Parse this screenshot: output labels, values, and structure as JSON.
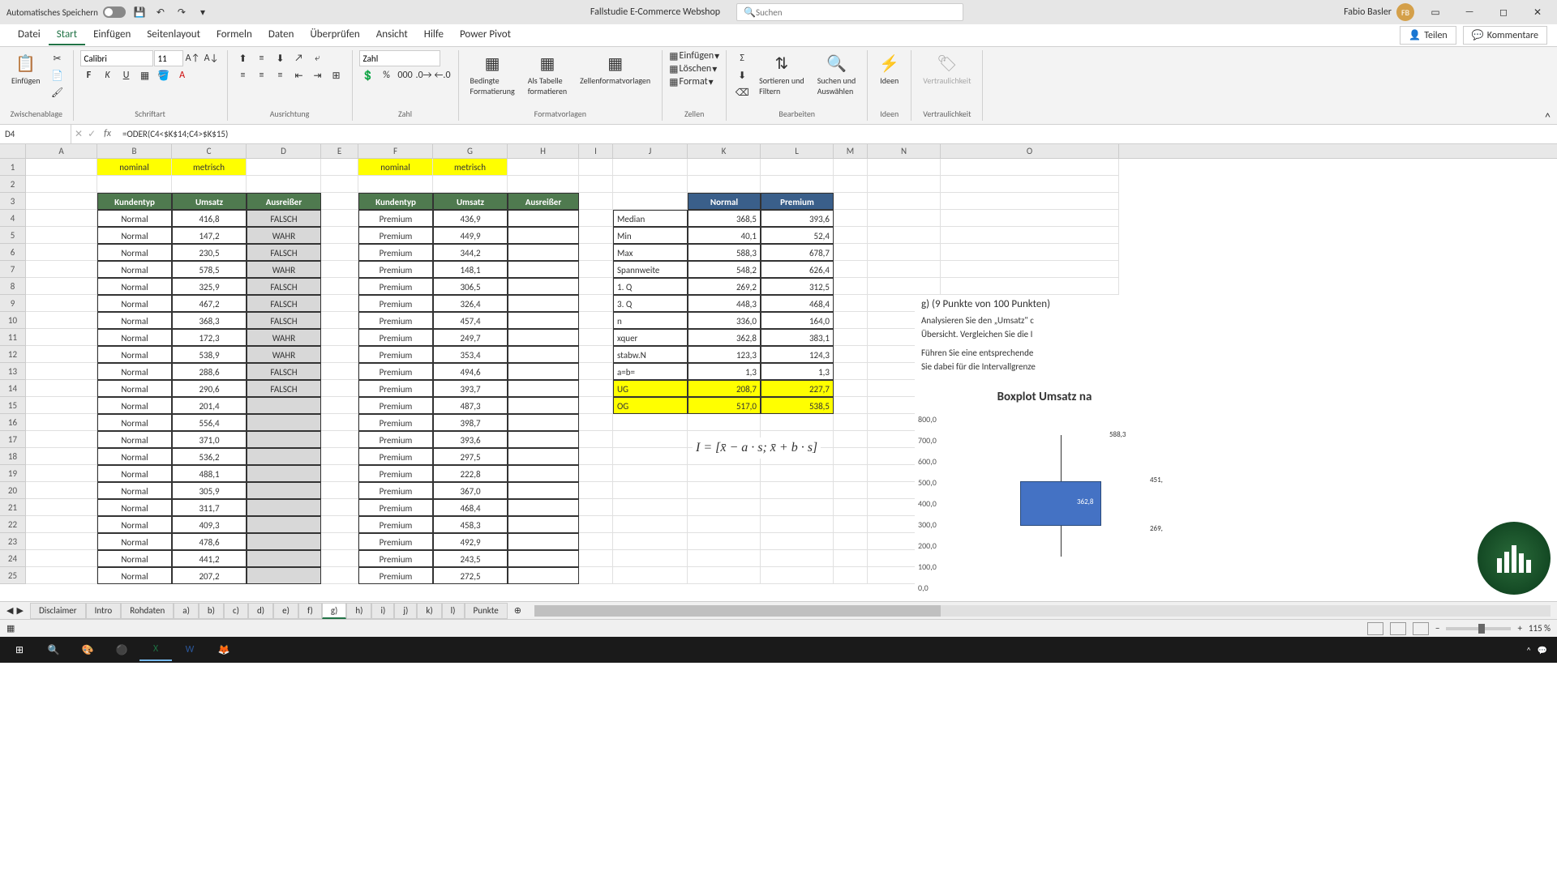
{
  "titlebar": {
    "autosave": "Automatisches Speichern",
    "doc_title": "Fallstudie E-Commerce Webshop",
    "search_placeholder": "Suchen",
    "user_name": "Fabio Basler",
    "user_initials": "FB"
  },
  "ribbon_tabs": [
    "Datei",
    "Start",
    "Einfügen",
    "Seitenlayout",
    "Formeln",
    "Daten",
    "Überprüfen",
    "Ansicht",
    "Hilfe",
    "Power Pivot"
  ],
  "ribbon_active": 1,
  "share": "Teilen",
  "comments": "Kommentare",
  "ribbon": {
    "paste": "Einfügen",
    "font_name": "Calibri",
    "font_size": "11",
    "num_format": "Zahl",
    "cond_fmt": "Bedingte\nFormatierung",
    "table_fmt": "Als Tabelle\nformatieren",
    "cell_styles": "Zellenformatvorlagen",
    "insert": "Einfügen",
    "delete": "Löschen",
    "format": "Format",
    "sort_filter": "Sortieren und\nFiltern",
    "find_select": "Suchen und\nAuswählen",
    "ideas": "Ideen",
    "sensitivity": "Vertraulichkeit",
    "g_clipboard": "Zwischenablage",
    "g_font": "Schriftart",
    "g_align": "Ausrichtung",
    "g_number": "Zahl",
    "g_styles": "Formatvorlagen",
    "g_cells": "Zellen",
    "g_editing": "Bearbeiten",
    "g_ideas": "Ideen",
    "g_sens": "Vertraulichkeit"
  },
  "namebox": "D4",
  "formula": "=ODER(C4<$K$14;C4>$K$15)",
  "columns": [
    "A",
    "B",
    "C",
    "D",
    "E",
    "F",
    "G",
    "H",
    "I",
    "J",
    "K",
    "L",
    "M",
    "N",
    "O"
  ],
  "col_widths": [
    "c-A",
    "c-B",
    "c-C",
    "c-D",
    "c-E",
    "c-F",
    "c-G",
    "c-H",
    "c-I",
    "c-J",
    "c-K",
    "c-L",
    "c-M",
    "c-N",
    "c-O"
  ],
  "labels": {
    "nominal": "nominal",
    "metrisch": "metrisch",
    "kundentyp": "Kundentyp",
    "umsatz": "Umsatz",
    "ausreisser": "Ausreißer",
    "normal": "Normal",
    "premium": "Premium"
  },
  "table1": [
    {
      "t": "Normal",
      "u": "416,8",
      "a": "FALSCH"
    },
    {
      "t": "Normal",
      "u": "147,2",
      "a": "WAHR"
    },
    {
      "t": "Normal",
      "u": "230,5",
      "a": "FALSCH"
    },
    {
      "t": "Normal",
      "u": "578,5",
      "a": "WAHR"
    },
    {
      "t": "Normal",
      "u": "325,9",
      "a": "FALSCH"
    },
    {
      "t": "Normal",
      "u": "467,2",
      "a": "FALSCH"
    },
    {
      "t": "Normal",
      "u": "368,3",
      "a": "FALSCH"
    },
    {
      "t": "Normal",
      "u": "172,3",
      "a": "WAHR"
    },
    {
      "t": "Normal",
      "u": "538,9",
      "a": "WAHR"
    },
    {
      "t": "Normal",
      "u": "288,6",
      "a": "FALSCH"
    },
    {
      "t": "Normal",
      "u": "290,6",
      "a": "FALSCH"
    },
    {
      "t": "Normal",
      "u": "201,4",
      "a": ""
    },
    {
      "t": "Normal",
      "u": "556,4",
      "a": ""
    },
    {
      "t": "Normal",
      "u": "371,0",
      "a": ""
    },
    {
      "t": "Normal",
      "u": "536,2",
      "a": ""
    },
    {
      "t": "Normal",
      "u": "488,1",
      "a": ""
    },
    {
      "t": "Normal",
      "u": "305,9",
      "a": ""
    },
    {
      "t": "Normal",
      "u": "311,7",
      "a": ""
    },
    {
      "t": "Normal",
      "u": "409,3",
      "a": ""
    },
    {
      "t": "Normal",
      "u": "478,6",
      "a": ""
    },
    {
      "t": "Normal",
      "u": "441,2",
      "a": ""
    },
    {
      "t": "Normal",
      "u": "207,2",
      "a": ""
    }
  ],
  "table2": [
    {
      "t": "Premium",
      "u": "436,9"
    },
    {
      "t": "Premium",
      "u": "449,9"
    },
    {
      "t": "Premium",
      "u": "344,2"
    },
    {
      "t": "Premium",
      "u": "148,1"
    },
    {
      "t": "Premium",
      "u": "306,5"
    },
    {
      "t": "Premium",
      "u": "326,4"
    },
    {
      "t": "Premium",
      "u": "457,4"
    },
    {
      "t": "Premium",
      "u": "249,7"
    },
    {
      "t": "Premium",
      "u": "353,4"
    },
    {
      "t": "Premium",
      "u": "494,6"
    },
    {
      "t": "Premium",
      "u": "393,7"
    },
    {
      "t": "Premium",
      "u": "487,3"
    },
    {
      "t": "Premium",
      "u": "398,7"
    },
    {
      "t": "Premium",
      "u": "393,6"
    },
    {
      "t": "Premium",
      "u": "297,5"
    },
    {
      "t": "Premium",
      "u": "222,8"
    },
    {
      "t": "Premium",
      "u": "367,0"
    },
    {
      "t": "Premium",
      "u": "468,4"
    },
    {
      "t": "Premium",
      "u": "458,3"
    },
    {
      "t": "Premium",
      "u": "492,9"
    },
    {
      "t": "Premium",
      "u": "243,5"
    },
    {
      "t": "Premium",
      "u": "272,5"
    }
  ],
  "stats": [
    {
      "l": "Median",
      "n": "368,5",
      "p": "393,6"
    },
    {
      "l": "Min",
      "n": "40,1",
      "p": "52,4"
    },
    {
      "l": "Max",
      "n": "588,3",
      "p": "678,7"
    },
    {
      "l": "Spannweite",
      "n": "548,2",
      "p": "626,4"
    },
    {
      "l": "1. Q",
      "n": "269,2",
      "p": "312,5"
    },
    {
      "l": "3. Q",
      "n": "448,3",
      "p": "468,4"
    },
    {
      "l": "n",
      "n": "336,0",
      "p": "164,0"
    },
    {
      "l": "xquer",
      "n": "362,8",
      "p": "383,1"
    },
    {
      "l": "stabw.N",
      "n": "123,3",
      "p": "124,3"
    },
    {
      "l": "a=b=",
      "n": "1,3",
      "p": "1,3"
    },
    {
      "l": "UG",
      "n": "208,7",
      "p": "227,7",
      "hl": true
    },
    {
      "l": "OG",
      "n": "517,0",
      "p": "538,5",
      "hl": true
    }
  ],
  "task_text": {
    "heading": "g) (9 Punkte von 100 Punkten)",
    "line1": "Analysieren Sie den „Umsatz\" c",
    "line2": "Übersicht. Vergleichen Sie die I",
    "line3": "Führen Sie eine entsprechende",
    "line4": "Sie dabei für die Intervallgrenze"
  },
  "formula_img": "I = [x̄ − a · s; x̄ + b · s]",
  "chart_data": {
    "type": "boxplot",
    "title": "Boxplot Umsatz na",
    "ylim": [
      0,
      800
    ],
    "yticks": [
      "0,0",
      "100,0",
      "200,0",
      "300,0",
      "400,0",
      "500,0",
      "600,0",
      "700,0",
      "800,0"
    ],
    "series": [
      {
        "name": "Normal",
        "q1": 269.2,
        "median": 362.8,
        "q3": 451.0,
        "min_whisker": 269.0,
        "max_whisker": 588.3,
        "labels": [
          "588,3",
          "451,",
          "362,8",
          "269,"
        ]
      }
    ]
  },
  "sheets": [
    "Disclaimer",
    "Intro",
    "Rohdaten",
    "a)",
    "b)",
    "c)",
    "d)",
    "e)",
    "f)",
    "g)",
    "h)",
    "i)",
    "j)",
    "k)",
    "l)",
    "Punkte"
  ],
  "active_sheet": 9,
  "zoom": "115 %"
}
